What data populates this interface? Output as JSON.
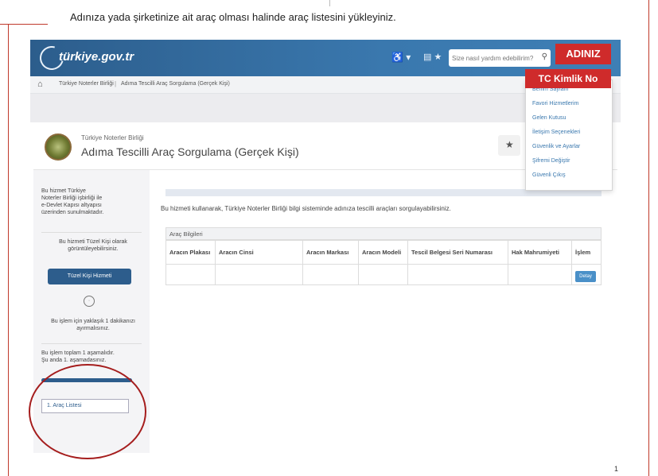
{
  "instruction": "Adınıza yada şirketinize ait araç olması halinde araç listesini yükleyiniz.",
  "page_mark": "1",
  "header": {
    "logo_text": "türkiye.gov.tr",
    "accessibility_label": "♿ ▾",
    "language_label": "▤ ★",
    "search_placeholder": "Size nasıl yardım edebilirim?"
  },
  "breadcrumb": [
    "Türkiye Noterler Birliği",
    "Adıma Tescilli Araç Sorgulama (Gerçek Kişi)"
  ],
  "service": {
    "org_name": "Türkiye Noterler Birliği",
    "title": "Adıma Tescilli Araç Sorgulama (Gerçek Kişi)"
  },
  "sidebar": {
    "note1": "Bu hizmet Türkiye Noterler Birliği işbirliği ile e-Devlet Kapısı altyapısı üzerinden sunulmaktadır.",
    "note2": "Bu hizmeti Tüzel Kişi olarak görüntüleyebilirsiniz.",
    "tuzel_button": "Tüzel Kişi Hizmeti",
    "note3": "Bu işlem için yaklaşık 1 dakikanızı ayırmalısınız.",
    "note4": "Bu işlem toplam 1 aşamalıdır. Şu anda 1. aşamadasınız.",
    "progress": 1.0,
    "step_label": "1. Araç Listesi"
  },
  "content": {
    "description": "Bu hizmeti kullanarak, Türkiye Noterler Birliği bilgi sisteminde adınıza tescilli araçları sorgulayabilirsiniz.",
    "table_caption": "Araç Bilgileri",
    "columns": [
      "Aracın Plakası",
      "Aracın Cinsi",
      "Aracın Markası",
      "Aracın Modeli",
      "Tescil Belgesi Seri Numarası",
      "Hak Mahrumiyeti",
      "İşlem"
    ],
    "detail_button": "Detay"
  },
  "user_menu": {
    "items": [
      "Benim Sayfam",
      "Favori Hizmetlerim",
      "Gelen Kutusu",
      "İletişim Seçenekleri",
      "Güvenlik ve Ayarlar",
      "Şifremi Değiştir",
      "Güvenli Çıkış"
    ]
  },
  "annotations": {
    "name_label": "ADINIZ",
    "id_label": "TC Kimlik No"
  },
  "colors": {
    "header_blue": "#3a78ae",
    "annotation_red": "#cf2b2b",
    "button_blue": "#2d5d8c"
  }
}
